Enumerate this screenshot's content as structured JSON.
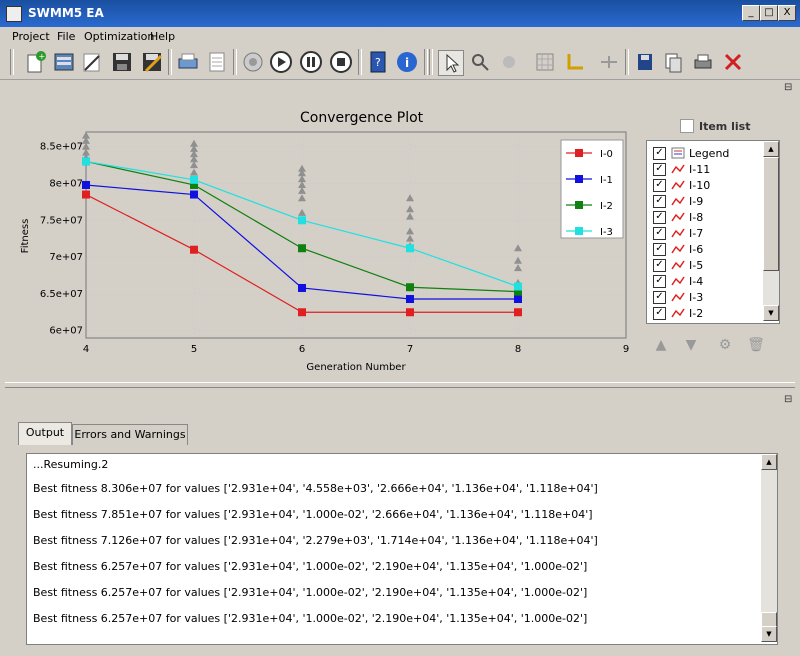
{
  "window": {
    "title": "SWMM5 EA",
    "btn_min": "_",
    "btn_max": "□",
    "btn_close": "X"
  },
  "menu": [
    "Project",
    "File",
    "Optimization",
    "Help"
  ],
  "toolbar_icons": [
    "new-icon",
    "open-icon",
    "edit-icon",
    "save-icon",
    "save-as-icon",
    "print-preview-icon",
    "page-icon",
    "target-icon",
    "play-icon",
    "pause-icon",
    "stop-icon",
    "help-book-icon",
    "info-icon",
    "pointer-icon",
    "zoom-icon",
    "pan-icon",
    "grid-icon",
    "axis-icon",
    "fit-icon",
    "export-icon",
    "copy-icon",
    "print-icon",
    "clear-icon"
  ],
  "dock_float_symbol": "⊟",
  "plot": {
    "title": "Convergence Plot",
    "item_list_label": "Item list"
  },
  "chart_data": {
    "type": "line",
    "title": "Convergence Plot",
    "xlabel": "Generation Number",
    "ylabel": "Fitness",
    "xlim": [
      4,
      9
    ],
    "ylim": [
      59000000,
      87000000
    ],
    "x_ticks": [
      4,
      5,
      6,
      7,
      8,
      9
    ],
    "y_ticks": [
      60000000,
      65000000,
      70000000,
      75000000,
      80000000,
      85000000
    ],
    "y_tick_labels": [
      "6e+07",
      "6.5e+07",
      "7e+07",
      "7.5e+07",
      "8e+07",
      "8.5e+07"
    ],
    "grid": true,
    "legend_position": "top-right",
    "series": [
      {
        "name": "I-0",
        "color": "#e02020",
        "x": [
          4,
          5,
          6,
          7,
          8
        ],
        "values": [
          78500000,
          71000000,
          62500000,
          62500000,
          62500000
        ]
      },
      {
        "name": "I-1",
        "color": "#1010e0",
        "x": [
          4,
          5,
          6,
          7,
          8
        ],
        "values": [
          79800000,
          78500000,
          65800000,
          64300000,
          64300000
        ]
      },
      {
        "name": "I-2",
        "color": "#108010",
        "x": [
          4,
          5,
          6,
          7,
          8
        ],
        "values": [
          83000000,
          79800000,
          71200000,
          65900000,
          65300000
        ]
      },
      {
        "name": "I-3",
        "color": "#20e0e0",
        "x": [
          4,
          5,
          6,
          7,
          8
        ],
        "values": [
          83000000,
          80500000,
          75000000,
          71200000,
          66000000
        ]
      }
    ],
    "population": {
      "color": "#909090",
      "x": [
        4,
        4,
        4,
        4,
        4,
        5,
        5,
        5,
        5,
        5,
        5,
        6,
        6,
        6,
        6,
        6,
        6,
        6,
        7,
        7,
        7,
        7,
        7,
        7,
        8,
        8,
        8,
        8
      ],
      "values": [
        86500000,
        85800000,
        85000000,
        84200000,
        83500000,
        85400000,
        84700000,
        84000000,
        83300000,
        82500000,
        81500000,
        82000000,
        81400000,
        80600000,
        79800000,
        79000000,
        78000000,
        76000000,
        78000000,
        76500000,
        75500000,
        73500000,
        72500000,
        71500000,
        71200000,
        69500000,
        68500000,
        66500000
      ]
    }
  },
  "legend_list": {
    "items": [
      "Legend",
      "I-11",
      "I-10",
      "I-9",
      "I-8",
      "I-7",
      "I-6",
      "I-5",
      "I-4",
      "I-3",
      "I-2"
    ]
  },
  "tabs": [
    "Output",
    "Errors and Warnings"
  ],
  "output": {
    "lines": [
      "...Resuming.2",
      "Best fitness 8.306e+07 for values ['2.931e+04', '4.558e+03', '2.666e+04', '1.136e+04', '1.118e+04']",
      "Best fitness 7.851e+07 for values ['2.931e+04', '1.000e-02', '2.666e+04', '1.136e+04', '1.118e+04']",
      "Best fitness 7.126e+07 for values ['2.931e+04', '2.279e+03', '1.714e+04', '1.136e+04', '1.118e+04']",
      "Best fitness 6.257e+07 for values ['2.931e+04', '1.000e-02', '2.190e+04', '1.135e+04', '1.000e-02']",
      "Best fitness 6.257e+07 for values ['2.931e+04', '1.000e-02', '2.190e+04', '1.135e+04', '1.000e-02']",
      "Best fitness 6.257e+07 for values ['2.931e+04', '1.000e-02', '2.190e+04', '1.135e+04', '1.000e-02']"
    ]
  }
}
